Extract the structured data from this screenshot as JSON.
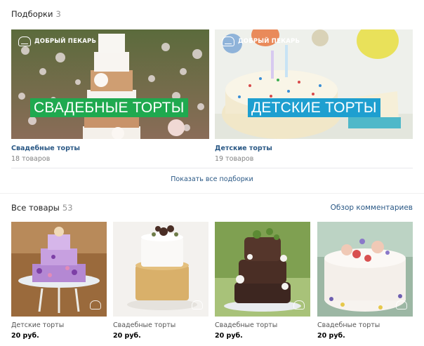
{
  "collections": {
    "title": "Подборки",
    "count": "3",
    "items": [
      {
        "name": "Свадебные торты",
        "count_label": "18 товаров",
        "banner": "СВАДЕБНЫЕ ТОРТЫ",
        "brand": "ДОБРЫЙ ПЕКАРЬ"
      },
      {
        "name": "Детские торты",
        "count_label": "19 товаров",
        "banner": "ДЕТСКИЕ ТОРТЫ",
        "brand": "ДОБРЫЙ ПЕКАРЬ"
      }
    ],
    "show_all": "Показать все подборки"
  },
  "products": {
    "title": "Все товары",
    "count": "53",
    "reviews_link": "Обзор комментариев",
    "items": [
      {
        "name": "Детские торты",
        "price": "20 руб."
      },
      {
        "name": "Свадебные торты",
        "price": "20 руб."
      },
      {
        "name": "Свадебные торты",
        "price": "20 руб."
      },
      {
        "name": "Свадебные торты",
        "price": "20 руб."
      }
    ]
  },
  "colors": {
    "link": "#2a5885",
    "banner_green": "#1fa94f",
    "banner_blue": "#1e9fd0"
  }
}
